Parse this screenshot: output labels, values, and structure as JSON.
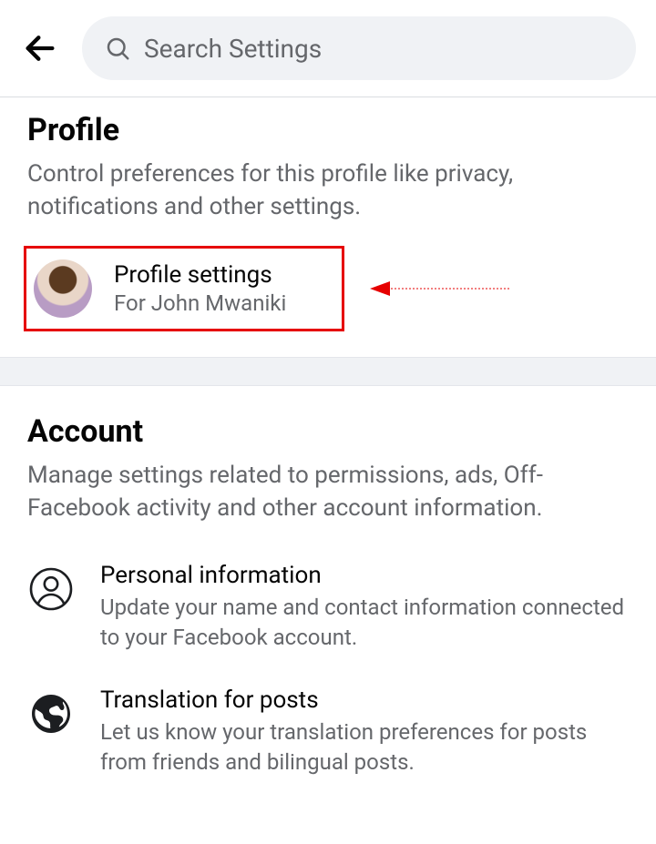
{
  "header": {
    "search_placeholder": "Search Settings"
  },
  "profile": {
    "title": "Profile",
    "description": "Control preferences for this profile like privacy, notifications and other settings.",
    "card": {
      "title": "Profile settings",
      "subtitle": "For John Mwaniki"
    }
  },
  "account": {
    "title": "Account",
    "description": "Manage settings related to permissions, ads, Off-Facebook activity and other account information.",
    "items": [
      {
        "title": "Personal information",
        "subtitle": "Update your name and contact information connected to your Facebook account."
      },
      {
        "title": "Translation for posts",
        "subtitle": "Let us know your translation preferences for posts from friends and bilingual posts."
      }
    ]
  }
}
